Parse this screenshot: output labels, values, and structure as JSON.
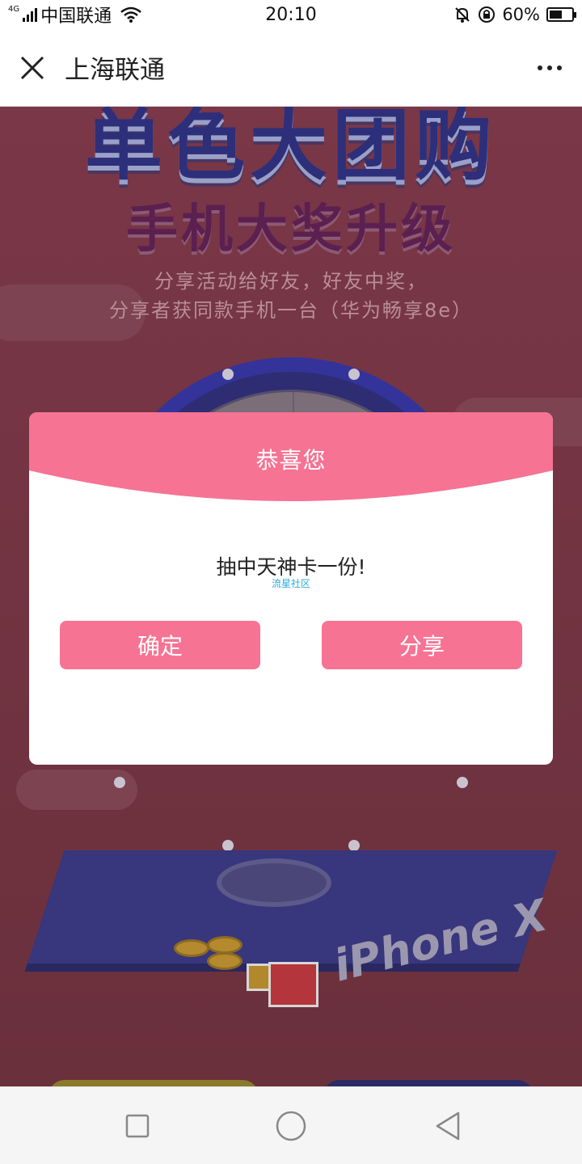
{
  "status_bar": {
    "network": "4G",
    "carrier": "中国联通",
    "time": "20:10",
    "battery": "60%",
    "battery_level": 0.6
  },
  "title_bar": {
    "title": "上海联通",
    "close_icon": "close-icon",
    "more_icon": "more-icon"
  },
  "background": {
    "headline": "单色大团购",
    "subhead": "手机大奖升级",
    "desc_line1": "分享活动给好友，好友中奖，",
    "desc_line2": "分享者获同款手机一台（华为畅享8e）",
    "product": "iPhone X"
  },
  "dialog": {
    "title": "恭喜您",
    "message": "抽中天神卡一份!",
    "watermark": "流星社区",
    "confirm_label": "确定",
    "share_label": "分享",
    "accent_color": "#f67393"
  },
  "nav_bar": {
    "recent_icon": "square-icon",
    "home_icon": "circle-icon",
    "back_icon": "triangle-back-icon"
  }
}
